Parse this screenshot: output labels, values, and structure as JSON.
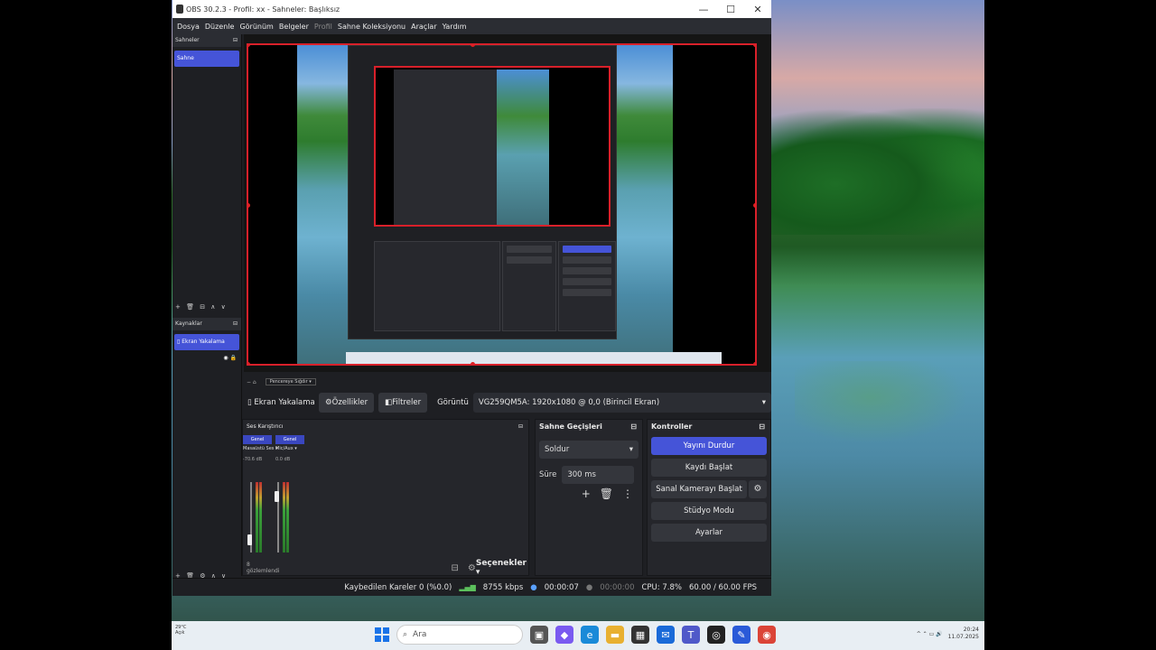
{
  "window": {
    "title": "OBS 30.2.3 - Profil: xx - Sahneler: Başlıksız",
    "minimize": "—",
    "maximize": "☐",
    "close": "✕"
  },
  "menu": {
    "items": [
      "Dosya",
      "Düzenle",
      "Görünüm",
      "Belgeler",
      "Profil",
      "Sahne Koleksiyonu",
      "Araçlar",
      "Yardım"
    ]
  },
  "scenes": {
    "header": "Sahneler",
    "items": [
      "Sahne"
    ],
    "toolbar": "+ 🗑 ⊟ ∧ ∨"
  },
  "sources": {
    "header": "Kaynaklar",
    "items": [
      "Ekran Yakalama"
    ],
    "toolbar": "+ 🗑 ⚙ ∧ ∨"
  },
  "source_bar_top": {
    "icons": "− ⌂",
    "select": "Pencereye Sığdır"
  },
  "source_bar": {
    "source_name": "Ekran Yakalama",
    "properties": "Özellikler",
    "filters": "Filtreler",
    "display_label": "Görüntü",
    "display_value": "VG259QM5A: 1920x1080 @ 0,0 (Birincil Ekran)"
  },
  "audio_mixer": {
    "header": "Ses Karıştırıcı",
    "channels": [
      {
        "group": "Genel",
        "name": "Masaüstü Ses",
        "db": "-70.6 dB",
        "level": 0.12
      },
      {
        "group": "Genel",
        "name": "Mic/Aux",
        "db": "0.0 dB",
        "level": 0.85
      }
    ],
    "footer_left": "8 gözlemlendi",
    "options": "Seçenekler"
  },
  "transitions": {
    "header": "Sahne Geçişleri",
    "selected": "Soldur",
    "duration_label": "Süre",
    "duration_value": "300 ms"
  },
  "controls": {
    "header": "Kontroller",
    "stop_stream": "Yayını Durdur",
    "start_recording": "Kaydı Başlat",
    "start_virtualcam": "Sanal Kamerayı Başlat",
    "studio_mode": "Stüdyo Modu",
    "settings": "Ayarlar"
  },
  "status": {
    "dropped_frames": "Kaybedilen Kareler 0 (%0.0)",
    "bitrate": "8755 kbps",
    "stream_time": "00:00:07",
    "record_time": "00:00:00",
    "cpu": "CPU: 7.8%",
    "fps": "60.00 / 60.00 FPS"
  },
  "taskbar": {
    "weather": "29°C Açık",
    "search_placeholder": "Ara",
    "tray": "^ ⌃ ▭ 🔊",
    "time": "20:24",
    "date": "11.07.2025"
  },
  "colors": {
    "accent": "#4554d8",
    "selection_border": "#d8202a"
  }
}
